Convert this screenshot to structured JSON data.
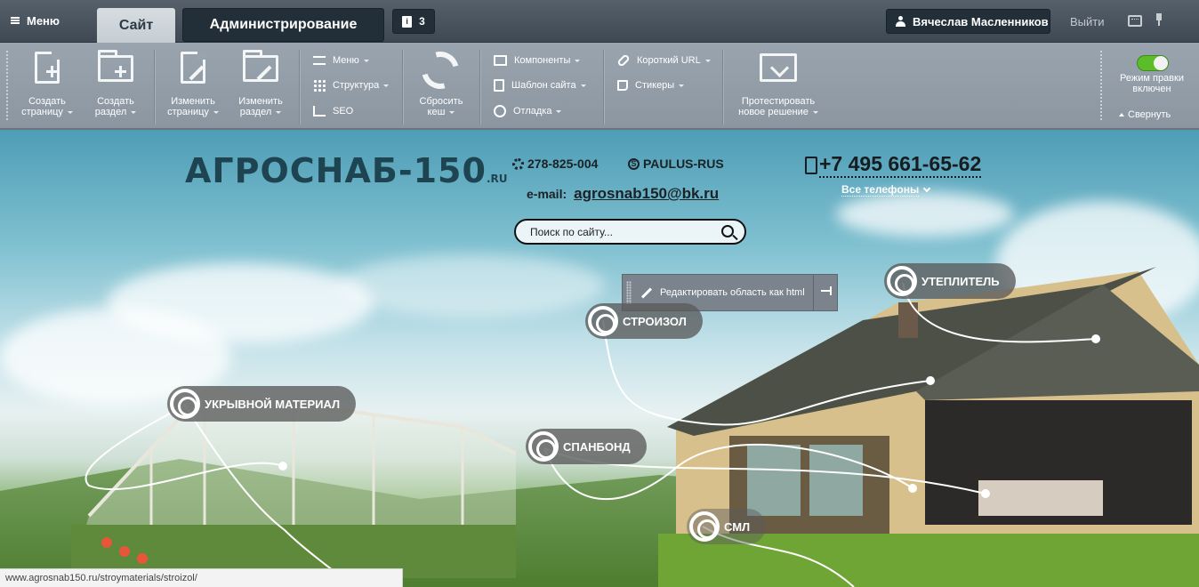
{
  "topbar": {
    "menu_label": "Меню",
    "tab_site": "Сайт",
    "tab_admin": "Администрирование",
    "notifications_count": "3",
    "user_name": "Вячеслав Масленников",
    "logout": "Выйти"
  },
  "toolbar": {
    "create_page": [
      "Создать",
      "страницу"
    ],
    "create_section": [
      "Создать",
      "раздел"
    ],
    "edit_page": [
      "Изменить",
      "страницу"
    ],
    "edit_section": [
      "Изменить",
      "раздел"
    ],
    "menu": "Меню",
    "structure": "Структура",
    "seo": "SEO",
    "clear_cache": [
      "Сбросить",
      "кеш"
    ],
    "components": "Компоненты",
    "site_template": "Шаблон сайта",
    "debug": "Отладка",
    "short_url": "Короткий URL",
    "stickers": "Стикеры",
    "test_solution": [
      "Протестировать",
      "новое решение"
    ],
    "edit_mode": [
      "Режим правки",
      "включен"
    ],
    "edit_mode_on": true,
    "collapse": "Свернуть"
  },
  "site": {
    "logo": "АГРОСНАБ-150",
    "logo_tld": ".RU",
    "phone_small": "278-825-004",
    "skype": "PAULUS-RUS",
    "email_label": "e-mail:",
    "email": "agrosnab150@bk.ru",
    "phone_main": "+7 495 661-65-62",
    "all_phones": "Все телефоны",
    "search_placeholder": "Поиск по сайту..."
  },
  "edit_popup": {
    "label": "Редактировать область как html"
  },
  "pins": {
    "insulation": "УТЕПЛИТЕЛЬ",
    "stroizol": "СТРОИЗОЛ",
    "covering": "УКРЫВНОЙ МАТЕРИАЛ",
    "spunbond": "СПАНБОНД",
    "sml": "СМЛ"
  },
  "statusbar": {
    "url": "www.agrosnab150.ru/stroymaterials/stroizol/"
  },
  "colors": {
    "topbar": "#4a545e",
    "toolbar": "#939da7",
    "toggle_on": "#5cbd2a",
    "pin_bg": "#5a5a5a"
  }
}
